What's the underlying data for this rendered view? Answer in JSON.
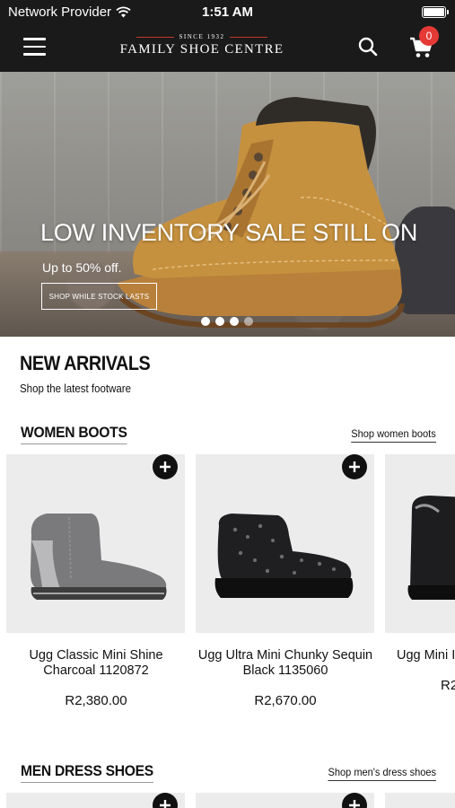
{
  "status_bar": {
    "carrier": "Network Provider",
    "time": "1:51 AM"
  },
  "header": {
    "logo_since": "SINCE 1932",
    "logo_name": "FAMILY SHOE CENTRE",
    "cart_count": "0"
  },
  "hero": {
    "title": "LOW INVENTORY SALE STILL ON",
    "subtitle": "Up to 50% off.",
    "cta": "SHOP WHILE STOCK LASTS",
    "slide_count": 4,
    "active_slide": 3
  },
  "new_arrivals": {
    "title": "NEW ARRIVALS",
    "subtitle": "Shop the latest footware"
  },
  "sections": [
    {
      "title": "WOMEN BOOTS",
      "link": "Shop women boots",
      "products": [
        {
          "name": "Ugg Classic Mini Shine Charcoal 1120872",
          "price": "R2,380.00"
        },
        {
          "name": "Ugg Ultra Mini Chunky Sequin Black 1135060",
          "price": "R2,670.00"
        },
        {
          "name": "Ugg Mini I Wash B",
          "price": "R2"
        }
      ]
    },
    {
      "title": "MEN DRESS SHOES",
      "link": "Shop men's dress shoes"
    }
  ],
  "colors": {
    "header_bg": "#1a1a1a",
    "badge": "#e53935",
    "card_bg": "#ececec"
  }
}
